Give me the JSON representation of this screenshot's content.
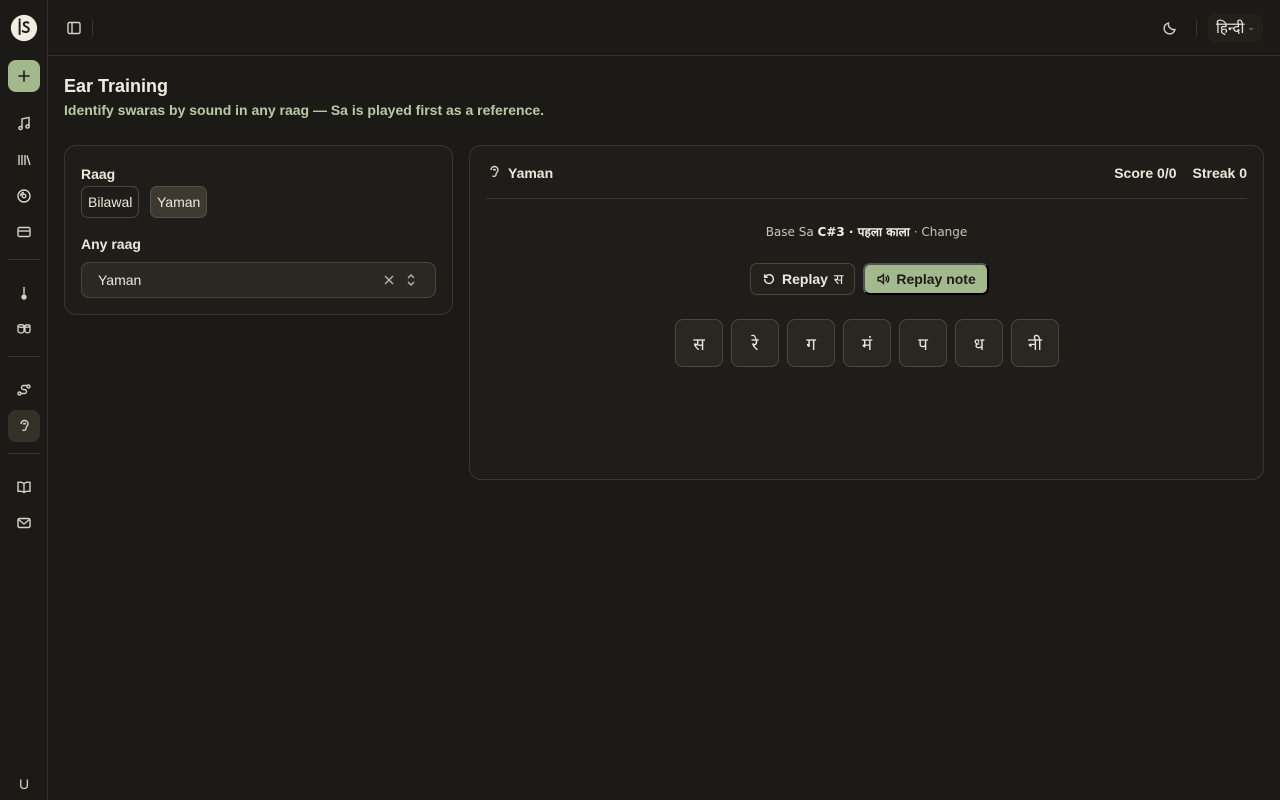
{
  "sidebar": {
    "logo_icon": "logo-icon",
    "items": [
      {
        "name": "new",
        "icon": "plus-icon"
      },
      {
        "name": "music",
        "icon": "music-note-icon"
      },
      {
        "name": "library",
        "icon": "library-icon"
      },
      {
        "name": "disc",
        "icon": "disc-icon"
      },
      {
        "name": "card",
        "icon": "card-icon"
      },
      {
        "name": "tuner",
        "icon": "thermometer-icon"
      },
      {
        "name": "tabla",
        "icon": "drums-icon"
      },
      {
        "name": "route",
        "icon": "route-icon"
      },
      {
        "name": "ear-training",
        "icon": "ear-icon"
      },
      {
        "name": "book",
        "icon": "book-icon"
      },
      {
        "name": "mail",
        "icon": "mail-icon"
      }
    ],
    "avatar": "U"
  },
  "topbar": {
    "language": "हिन्दी"
  },
  "page": {
    "title": "Ear Training",
    "subtitle": "Identify swaras by sound in any raag — Sa is played first as a reference."
  },
  "settings": {
    "raag_label": "Raag",
    "raag_options": [
      "Bilawal",
      "Yaman"
    ],
    "raag_selected": "Yaman",
    "any_raag_label": "Any raag",
    "any_raag_value": "Yaman"
  },
  "trainer": {
    "raag": "Yaman",
    "score_label": "Score",
    "score_value": "0/0",
    "streak_label": "Streak",
    "streak_value": "0",
    "base_prefix": "Base Sa",
    "base_note": "C#3 · पहला काला",
    "base_sep": "·",
    "change_label": "Change",
    "replay_sa_label": "Replay",
    "replay_sa_glyph": "स",
    "replay_note_label": "Replay note",
    "swaras": [
      "स",
      "रे",
      "ग",
      "मं",
      "प",
      "ध",
      "नी"
    ]
  },
  "colors": {
    "accent": "#a3b98d",
    "background": "#1c1a16"
  }
}
